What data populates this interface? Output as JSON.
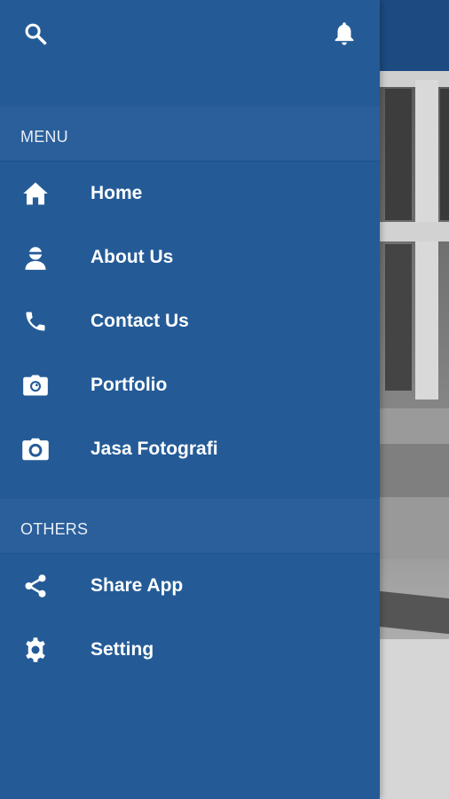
{
  "drawer": {
    "top_icons": {
      "search": "search-icon",
      "notifications": "bell-icon"
    },
    "sections": {
      "menu": {
        "title": "MENU",
        "items": [
          {
            "label": "Home",
            "icon": "home-icon"
          },
          {
            "label": "About Us",
            "icon": "person-icon"
          },
          {
            "label": "Contact Us",
            "icon": "phone-icon"
          },
          {
            "label": "Portfolio",
            "icon": "camera-outline-icon"
          },
          {
            "label": "Jasa Fotografi",
            "icon": "camera-icon"
          }
        ]
      },
      "others": {
        "title": "OTHERS",
        "items": [
          {
            "label": "Share App",
            "icon": "share-icon"
          },
          {
            "label": "Setting",
            "icon": "gear-icon"
          }
        ]
      }
    }
  },
  "colors": {
    "drawer_bg": "#245b97",
    "section_bg": "#2a5f9b",
    "text": "#ffffff"
  }
}
